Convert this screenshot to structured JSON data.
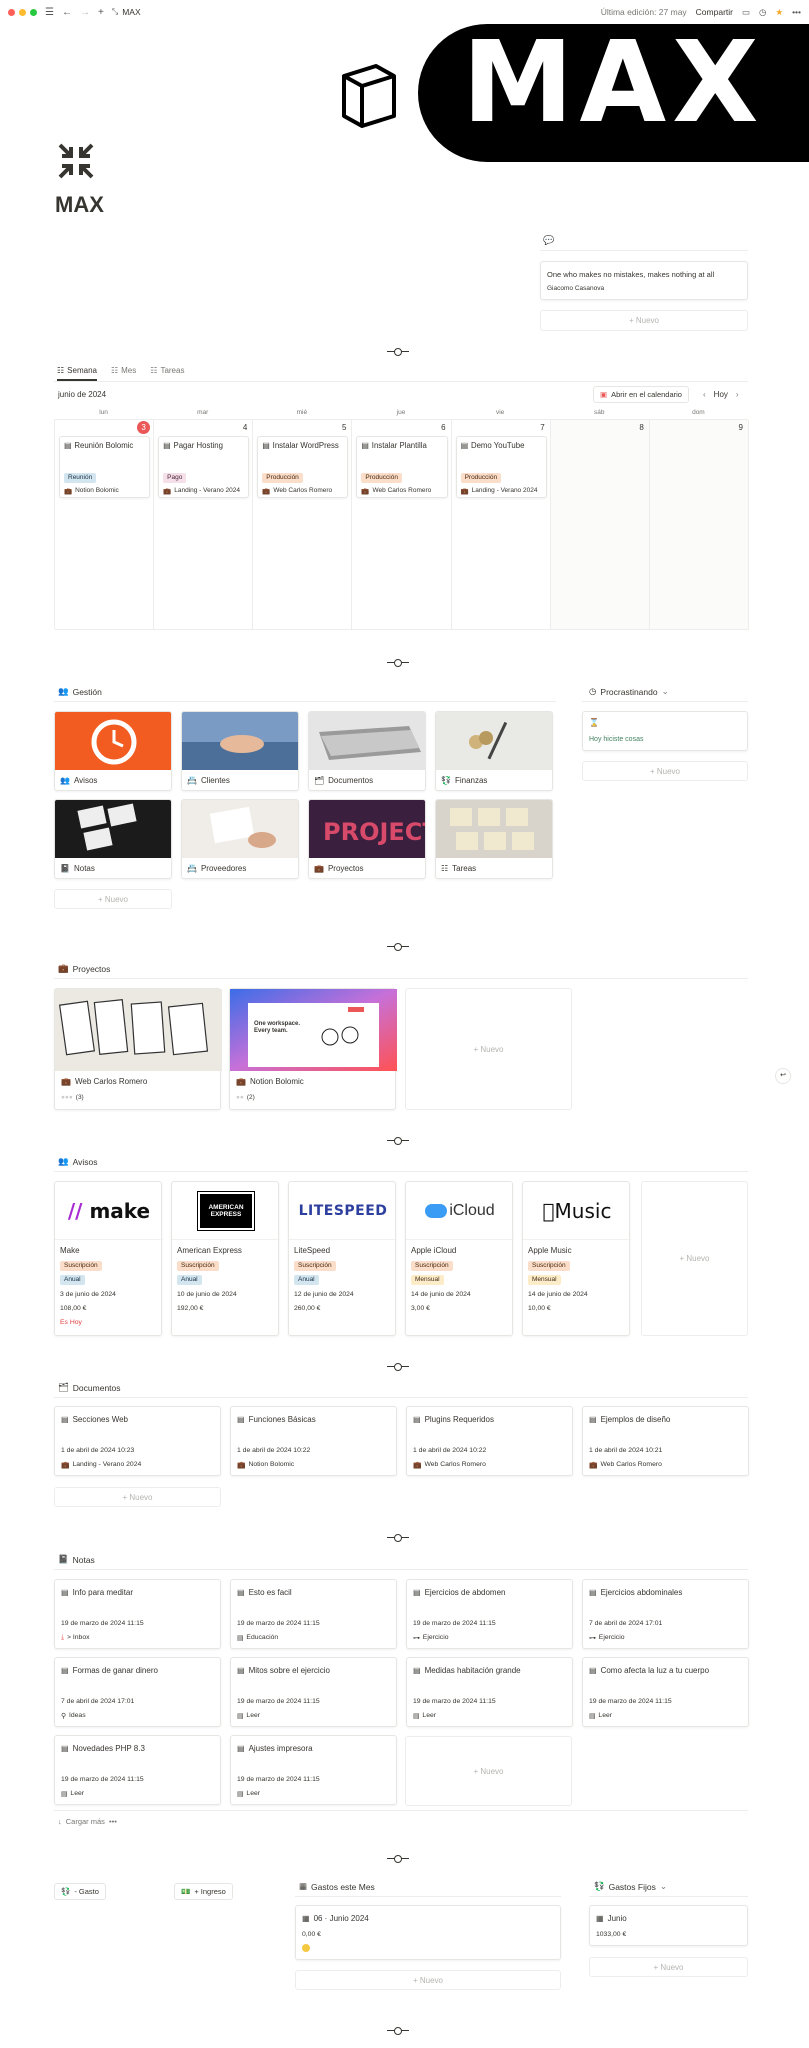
{
  "topbar": {
    "breadcrumb": "MAX",
    "edited": "Última edición: 27 may",
    "share": "Compartir"
  },
  "cover": {
    "text": "MAX"
  },
  "page": {
    "title": "MAX"
  },
  "quote": {
    "text": "One who makes no mistakes, makes nothing at all",
    "author": "Giacomo Casanova",
    "new": "+ Nuevo"
  },
  "calendar": {
    "tabs": [
      "Semana",
      "Mes",
      "Tareas"
    ],
    "month": "junio de 2024",
    "open_btn": "Abrir en el calendario",
    "today": "Hoy",
    "days": [
      "lun",
      "mar",
      "mié",
      "jue",
      "vie",
      "sáb",
      "dom"
    ],
    "dates": [
      "3",
      "4",
      "5",
      "6",
      "7",
      "8",
      "9"
    ],
    "events": [
      {
        "title": "Reunión Bolomic",
        "tag": "Reunión",
        "tagclass": "t-blue",
        "proj": "Notion Bolomic"
      },
      {
        "title": "Pagar Hosting",
        "tag": "Pago",
        "tagclass": "t-pink",
        "proj": "Landing - Verano 2024"
      },
      {
        "title": "Instalar WordPress",
        "tag": "Producción",
        "tagclass": "t-orange",
        "proj": "Web Carlos Romero"
      },
      {
        "title": "Instalar Plantilla",
        "tag": "Producción",
        "tagclass": "t-orange",
        "proj": "Web Carlos Romero"
      },
      {
        "title": "Demo YouTube",
        "tag": "Producción",
        "tagclass": "t-orange",
        "proj": "Landing - Verano 2024"
      }
    ]
  },
  "gestion": {
    "title": "Gestión",
    "items": [
      "Avisos",
      "Clientes",
      "Documentos",
      "Finanzas",
      "Notas",
      "Proveedores",
      "Proyectos",
      "Tareas"
    ],
    "new": "+ Nuevo"
  },
  "procrastinando": {
    "title": "Procrastinando",
    "text": "Hoy hiciste cosas",
    "new": "+ Nuevo"
  },
  "proyectos": {
    "title": "Proyectos",
    "items": [
      {
        "name": "Web Carlos Romero",
        "count": "(3)"
      },
      {
        "name": "Notion Bolomic",
        "count": "(2)"
      }
    ],
    "new": "+ Nuevo",
    "img2_line1": "One workspace.",
    "img2_line2": "Every team."
  },
  "avisos": {
    "title": "Avisos",
    "items": [
      {
        "logo": "make",
        "name": "Make",
        "plan": "Suscripción",
        "period": "Anual",
        "date": "3 de junio de 2024",
        "price": "108,00 €",
        "alert": "Es Hoy"
      },
      {
        "logo": "AMERICAN EXPRESS",
        "name": "American Express",
        "plan": "Suscripción",
        "period": "Anual",
        "date": "10 de junio de 2024",
        "price": "192,00 €",
        "alert": ""
      },
      {
        "logo": "LITESPEED",
        "name": "LiteSpeed",
        "plan": "Suscripción",
        "period": "Anual",
        "date": "12 de junio de 2024",
        "price": "260,00 €",
        "alert": ""
      },
      {
        "logo": "iCloud",
        "name": "Apple iCloud",
        "plan": "Suscripción",
        "period": "Mensual",
        "date": "14 de junio de 2024",
        "price": "3,00 €",
        "alert": ""
      },
      {
        "logo": "Music",
        "name": "Apple Music",
        "plan": "Suscripción",
        "period": "Mensual",
        "date": "14 de junio de 2024",
        "price": "10,00 €",
        "alert": ""
      }
    ],
    "new": "+ Nuevo"
  },
  "documentos": {
    "title": "Documentos",
    "items": [
      {
        "title": "Secciones Web",
        "date": "1 de abril de 2024 10:23",
        "proj": "Landing - Verano 2024"
      },
      {
        "title": "Funciones Básicas",
        "date": "1 de abril de 2024 10:22",
        "proj": "Notion Bolomic"
      },
      {
        "title": "Plugins Requeridos",
        "date": "1 de abril de 2024 10:22",
        "proj": "Web Carlos Romero"
      },
      {
        "title": "Ejemplos de diseño",
        "date": "1 de abril de 2024 10:21",
        "proj": "Web Carlos Romero"
      }
    ],
    "new": "+ Nuevo"
  },
  "notas": {
    "title": "Notas",
    "items": [
      {
        "title": "Info para meditar",
        "date": "19 de marzo de 2024 11:15",
        "cat": "> Inbox"
      },
      {
        "title": "Esto es facil",
        "date": "19 de marzo de 2024 11:15",
        "cat": "Educación"
      },
      {
        "title": "Ejercicios de abdomen",
        "date": "19 de marzo de 2024 11:15",
        "cat": "Ejercicio"
      },
      {
        "title": "Ejercicios abdominales",
        "date": "7 de abril de 2024 17:01",
        "cat": "Ejercicio"
      },
      {
        "title": "Formas de ganar dinero",
        "date": "7 de abril de 2024 17:01",
        "cat": "Ideas"
      },
      {
        "title": "Mitos sobre el ejercicio",
        "date": "19 de marzo de 2024 11:15",
        "cat": "Leer"
      },
      {
        "title": "Medidas habitación grande",
        "date": "19 de marzo de 2024 11:15",
        "cat": "Leer"
      },
      {
        "title": "Como afecta la luz a tu cuerpo",
        "date": "19 de marzo de 2024 11:15",
        "cat": "Leer"
      },
      {
        "title": "Novedades PHP 8.3",
        "date": "19 de marzo de 2024 11:15",
        "cat": "Leer"
      },
      {
        "title": "Ajustes impresora",
        "date": "19 de marzo de 2024 11:15",
        "cat": "Leer"
      }
    ],
    "new": "+ Nuevo",
    "load_more": "Cargar más"
  },
  "finanzas": {
    "gasto_btn": "- Gasto",
    "ingreso_btn": "+ Ingreso",
    "gastos_mes": "Gastos este Mes",
    "mes_item": "06 · Junio 2024",
    "mes_amount": "0,00 €",
    "gastos_fijos": "Gastos Fijos",
    "fijo_item": "Junio",
    "fijo_amount": "1033,00 €",
    "new": "+ Nuevo"
  },
  "colors": {
    "accent": "#eb5757",
    "green": "#448361",
    "red": "#e03e3e"
  }
}
